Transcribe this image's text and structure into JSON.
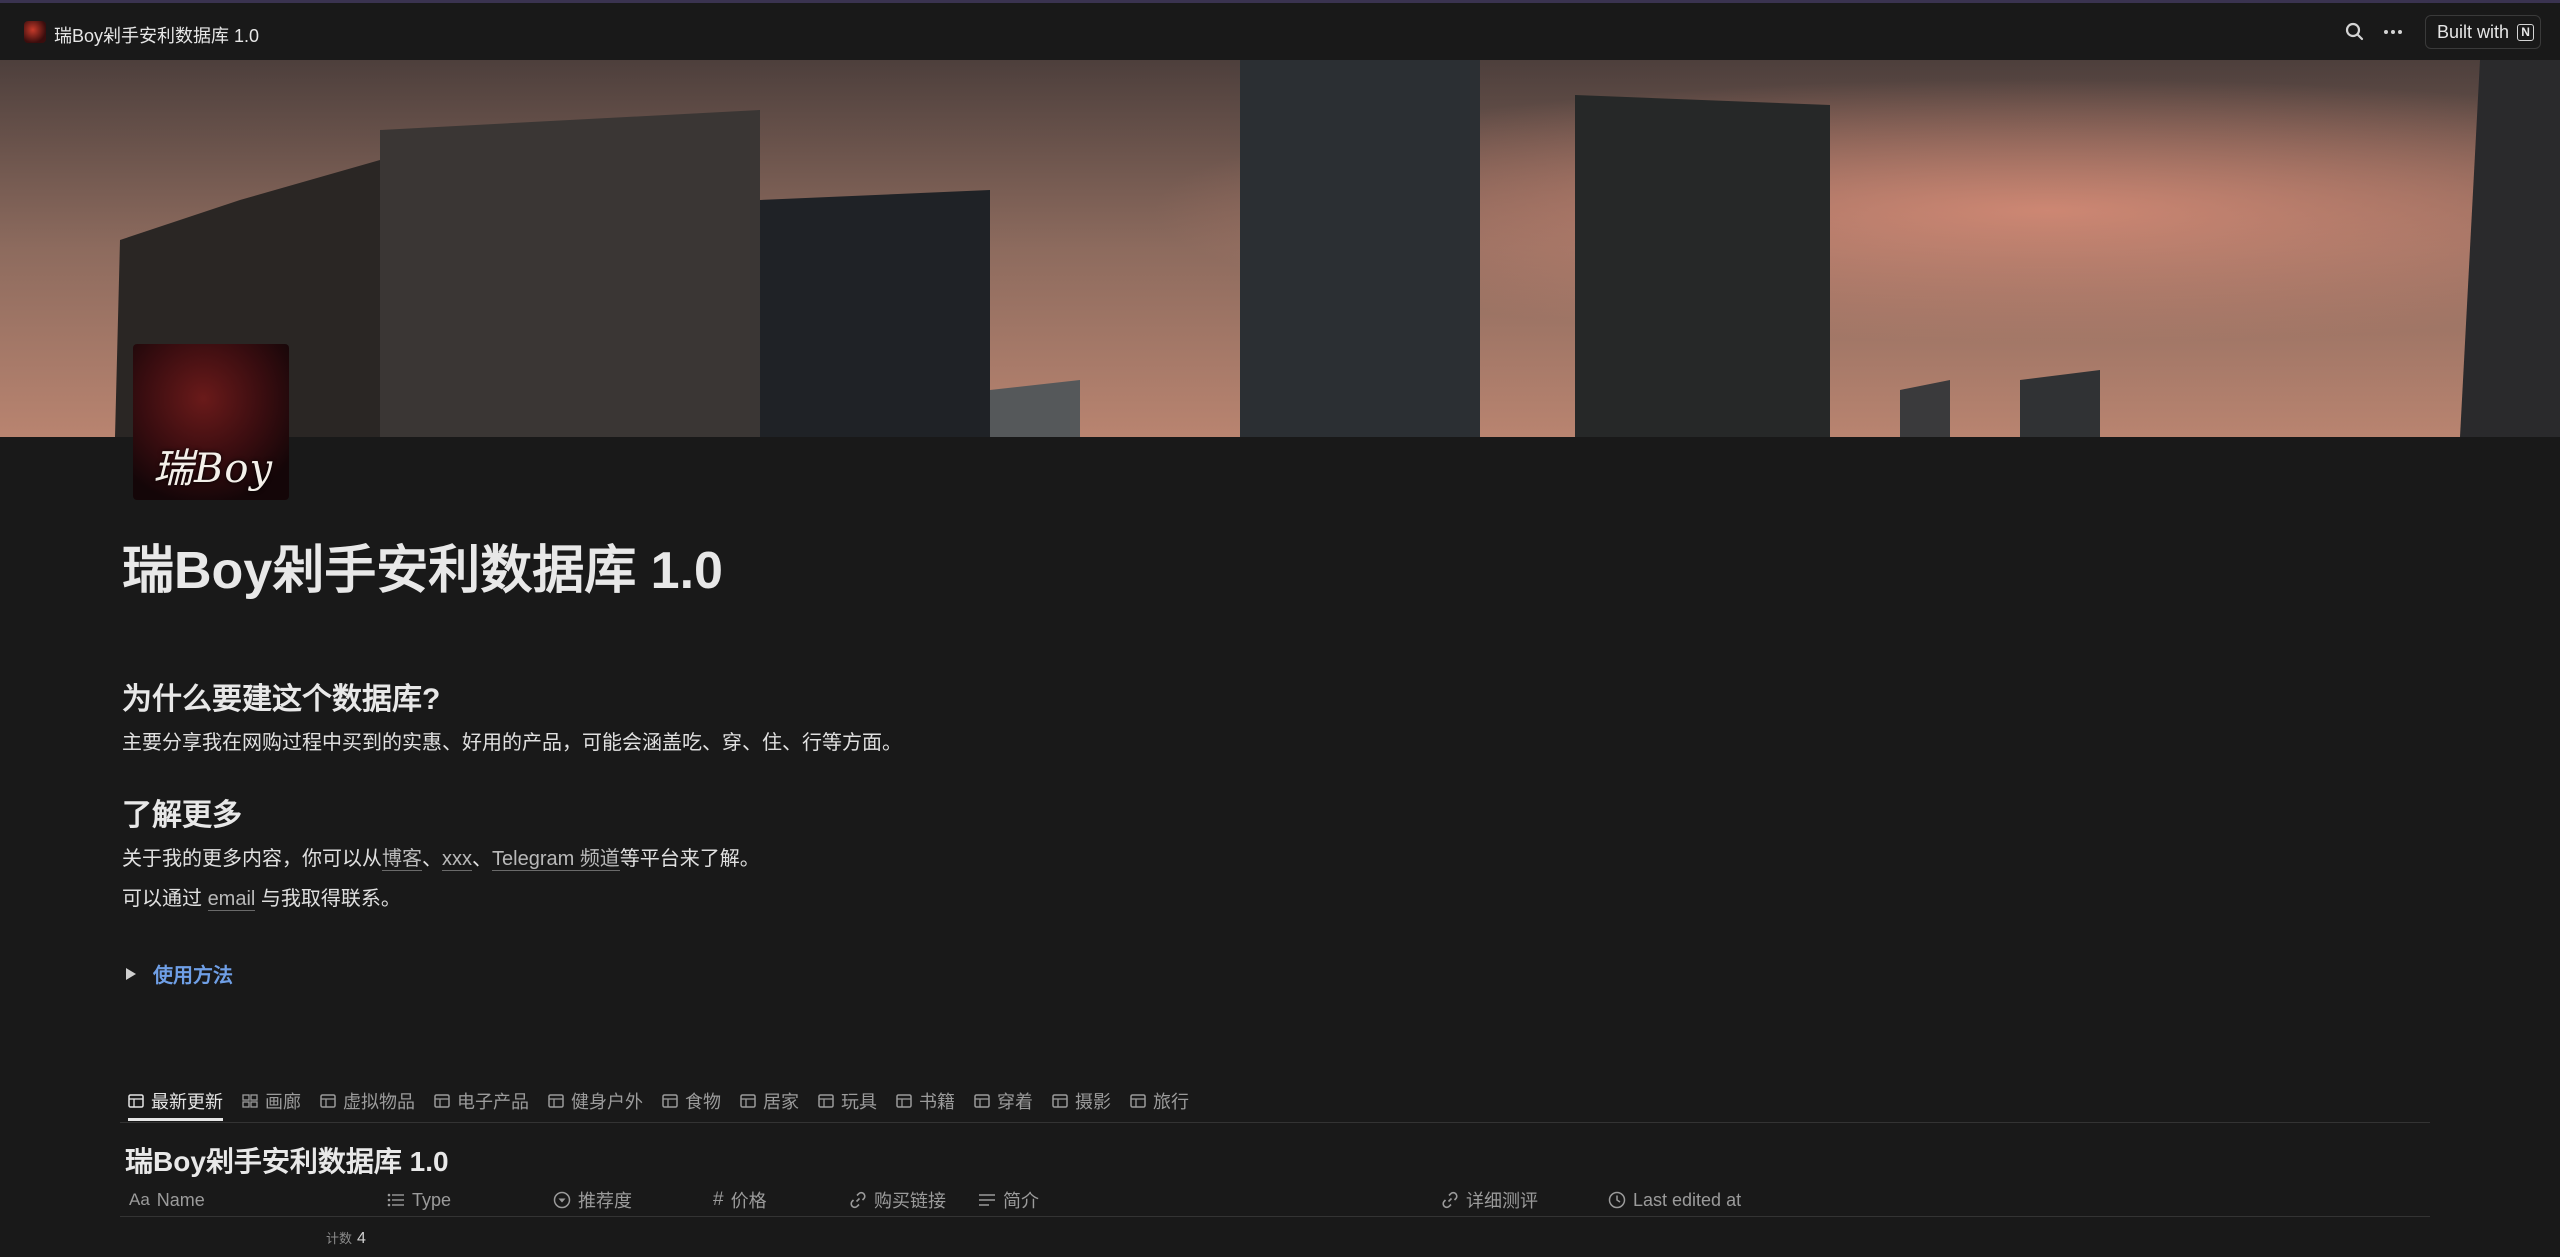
{
  "app": {
    "title": "瑞Boy剁手安利数据库 1.0",
    "built_with_label": "Built with"
  },
  "page": {
    "title": "瑞Boy剁手安利数据库 1.0",
    "icon_text": "瑞Boy",
    "sections": [
      {
        "heading": "为什么要建这个数据库?",
        "lines": [
          [
            "主要分享我在网购过程中买到的实惠、好用的产品，可能会涵盖吃、穿、住、行等方面。"
          ]
        ]
      },
      {
        "heading": "了解更多",
        "lines": [
          [
            "关于我的更多内容，你可以从",
            "博客",
            "、",
            "xxx",
            "、",
            "Telegram 频道",
            "等平台来了解。"
          ],
          [
            "可以通过 ",
            "email",
            " 与我取得联系。"
          ]
        ]
      }
    ],
    "toggle_label": "使用方法"
  },
  "database": {
    "tabs": [
      "最新更新",
      "画廊",
      "虚拟物品",
      "电子产品",
      "健身户外",
      "食物",
      "居家",
      "玩具",
      "书籍",
      "穿着",
      "摄影",
      "旅行"
    ],
    "active_tab": "最新更新",
    "title": "瑞Boy剁手安利数据库 1.0",
    "columns": [
      "Name",
      "Type",
      "推荐度",
      "价格",
      "购买链接",
      "简介",
      "详细测评",
      "Last edited at"
    ],
    "count_label": "计数",
    "count_value": "4"
  }
}
